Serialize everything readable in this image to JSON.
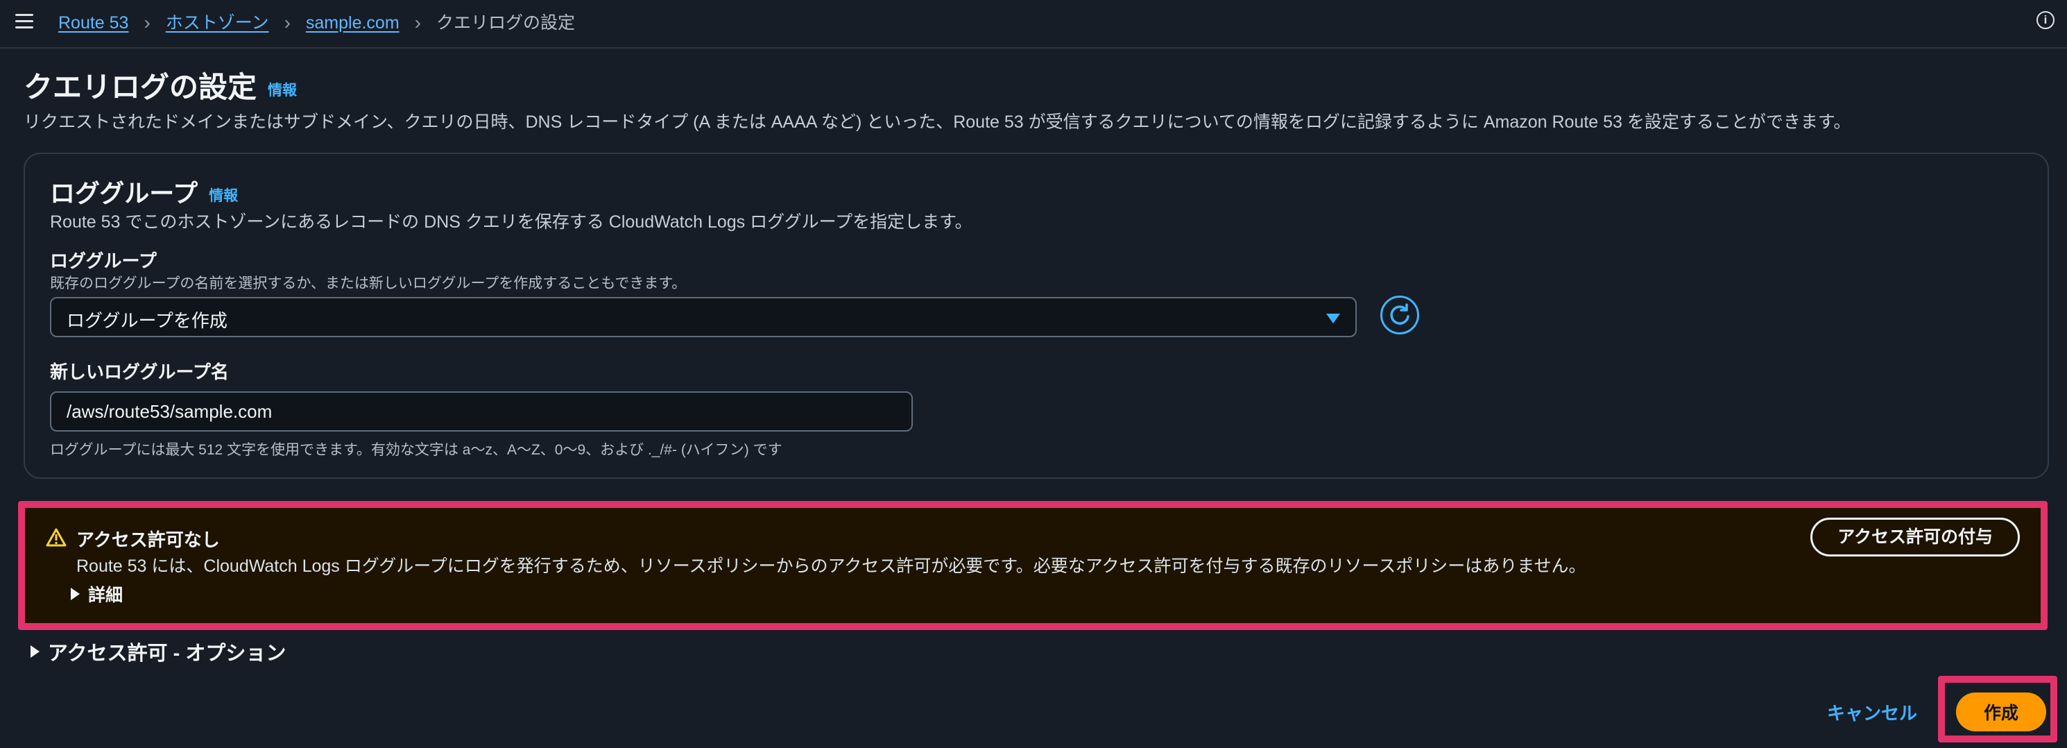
{
  "breadcrumb": {
    "items": [
      "Route 53",
      "ホストゾーン",
      "sample.com"
    ],
    "current": "クエリログの設定"
  },
  "page": {
    "title": "クエリログの設定",
    "info_link": "情報",
    "description": "リクエストされたドメインまたはサブドメイン、クエリの日時、DNS レコードタイプ (A または AAAA など) といった、Route 53 が受信するクエリについての情報をログに記録するように Amazon Route 53 を設定することができます。"
  },
  "log_group_panel": {
    "title": "ロググループ",
    "info_link": "情報",
    "description": "Route 53 でこのホストゾーンにあるレコードの DNS クエリを保存する CloudWatch Logs ロググループを指定します。",
    "select_label": "ロググループ",
    "select_hint": "既存のロググループの名前を選択するか、または新しいロググループを作成することもできます。",
    "select_value": "ロググループを作成",
    "name_label": "新しいロググループ名",
    "name_value": "/aws/route53/sample.com",
    "name_constraint": "ロググループには最大 512 文字を使用できます。有効な文字は a〜z、A〜Z、0〜9、および ._/#- (ハイフン) です"
  },
  "alert": {
    "title": "アクセス許可なし",
    "message": "Route 53 には、CloudWatch Logs ロググループにログを発行するため、リソースポリシーからのアクセス許可が必要です。必要なアクセス許可を付与する既存のリソースポリシーはありません。",
    "details_label": "詳細",
    "grant_button": "アクセス許可の付与"
  },
  "permissions_expander": "アクセス許可 - オプション",
  "footer": {
    "cancel": "キャンセル",
    "create": "作成"
  },
  "colors": {
    "background": "#161d26",
    "link": "#42b4ff",
    "primary_button": "#ff9900",
    "highlight": "#e2326a",
    "alert_background": "#1d1300"
  },
  "icons": [
    "menu-icon",
    "chevron-right-icon",
    "info-icon",
    "caret-down-icon",
    "refresh-icon",
    "warning-icon",
    "caret-right-icon"
  ]
}
